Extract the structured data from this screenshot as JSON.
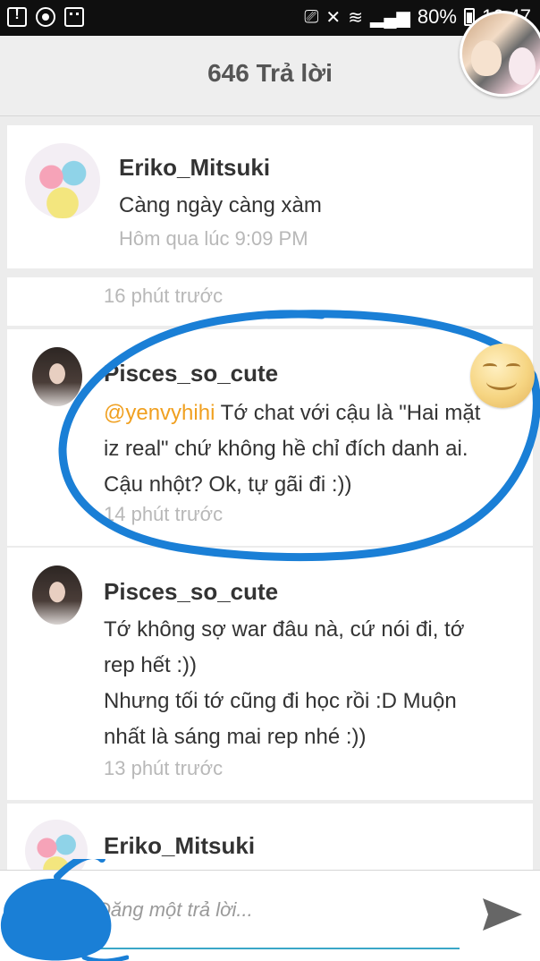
{
  "status_bar": {
    "battery": "80%",
    "time": "16:47",
    "icons": [
      "alert-icon",
      "eye-icon",
      "face-icon",
      "cast-icon",
      "mute-icon",
      "wifi-icon",
      "signal-icon",
      "battery-icon"
    ]
  },
  "header": {
    "title": "646 Trả lời"
  },
  "posts": [
    {
      "user": "Eriko_Mitsuki",
      "text": "Càng ngày càng xàm",
      "time": "Hôm qua lúc 9:09 PM"
    },
    {
      "time": "16 phút trước"
    },
    {
      "user": "Pisces_so_cute",
      "mention": "@yenvyhihi",
      "text_line1": " Tớ chat với cậu là \"Hai mặt",
      "text_line2": "iz real\" chứ không hề chỉ đích danh ai.",
      "text_line3": "Cậu nhột? Ok, tự gãi đi :))",
      "time": "14 phút trước"
    },
    {
      "user": "Pisces_so_cute",
      "text_line1": "Tớ không sợ war đâu nà, cứ nói đi, tớ",
      "text_line2": "rep hết :))",
      "text_line3": "Nhưng tối tớ cũng đi học rồi :D Muộn",
      "text_line4": "nhất là sáng mai rep nhé :))",
      "time": "13 phút trước"
    },
    {
      "user": "Eriko_Mitsuki"
    }
  ],
  "reply": {
    "placeholder": "Đăng một trả lời..."
  },
  "colors": {
    "mention": "#f0a020",
    "annotation": "#1a7fd6",
    "input_underline": "#3aa7c7"
  }
}
